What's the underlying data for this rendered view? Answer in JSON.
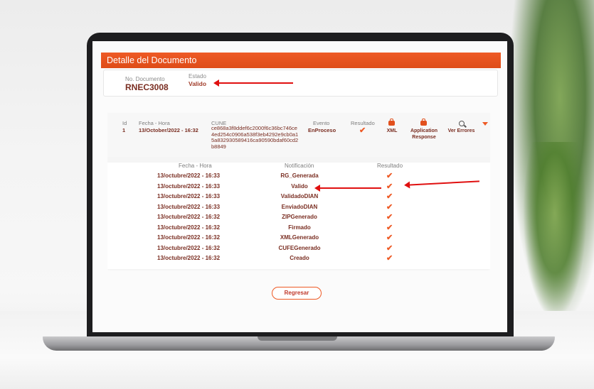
{
  "header": {
    "title": "Detalle del Documento"
  },
  "document": {
    "number_label": "No. Documento",
    "number": "RNEC3008",
    "status_label": "Estado",
    "status": "Valido"
  },
  "event": {
    "columns": {
      "id": "Id",
      "fecha_hora": "Fecha - Hora",
      "cune": "CUNE",
      "evento": "Evento",
      "resultado": "Resultado"
    },
    "row": {
      "id": "1",
      "fecha_hora": "13/October/2022 - 16:32",
      "cune": "ce868a3f8ddef6c2000f6c36bc746ce4ed254c0906a538f3eb4292e9cb0a15a832930589416ca90590bdaf60cd2b8849",
      "evento": "EnProceso"
    },
    "actions": {
      "xml": "XML",
      "application_response": "Application Response",
      "ver_errores": "Ver Errores"
    },
    "colors": {
      "accent": "#ee5a25",
      "text": "#7a2e22",
      "arrow": "#e01010"
    },
    "icons": [
      "check-icon",
      "briefcase-icon",
      "search-icon",
      "caret-down-icon"
    ]
  },
  "notifications": {
    "headers": {
      "fecha_hora": "Fecha - Hora",
      "notificacion": "Notificación",
      "resultado": "Resultado"
    },
    "rows": [
      {
        "fecha": "13/octubre/2022 - 16:33",
        "notificacion": "RG_Generada"
      },
      {
        "fecha": "13/octubre/2022 - 16:33",
        "notificacion": "Valido"
      },
      {
        "fecha": "13/octubre/2022 - 16:33",
        "notificacion": "ValidadoDIAN"
      },
      {
        "fecha": "13/octubre/2022 - 16:33",
        "notificacion": "EnviadoDIAN"
      },
      {
        "fecha": "13/octubre/2022 - 16:32",
        "notificacion": "ZIPGenerado"
      },
      {
        "fecha": "13/octubre/2022 - 16:32",
        "notificacion": "Firmado"
      },
      {
        "fecha": "13/octubre/2022 - 16:32",
        "notificacion": "XMLGenerado"
      },
      {
        "fecha": "13/octubre/2022 - 16:32",
        "notificacion": "CUFEGenerado"
      },
      {
        "fecha": "13/octubre/2022 - 16:32",
        "notificacion": "Creado"
      }
    ]
  },
  "footer": {
    "back_button": "Regresar"
  }
}
